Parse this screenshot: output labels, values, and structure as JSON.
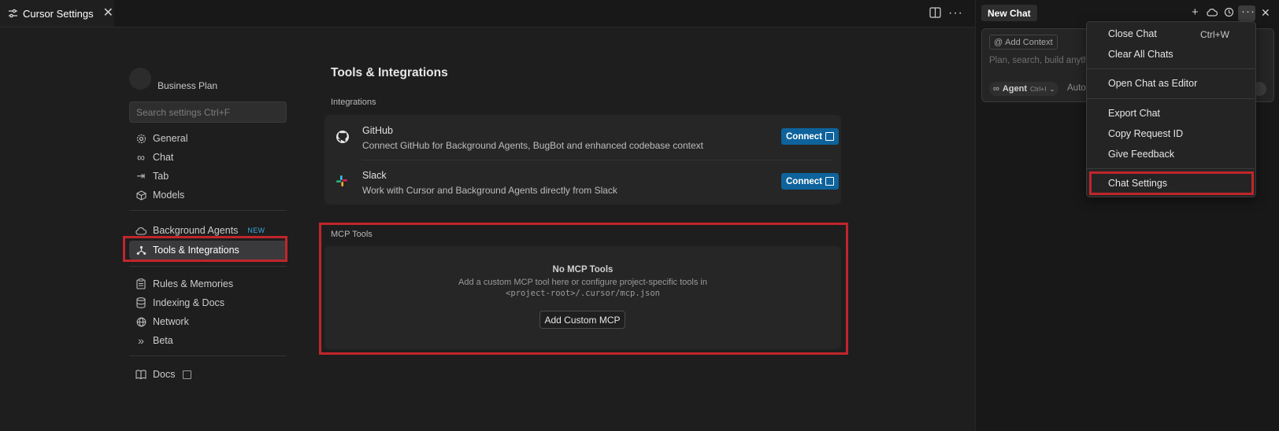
{
  "tab": {
    "title": "Cursor Settings"
  },
  "sidebar": {
    "plan": "Business Plan",
    "search_placeholder": "Search settings Ctrl+F",
    "items": [
      {
        "label": "General",
        "icon": "gear-icon"
      },
      {
        "label": "Chat",
        "icon": "infinity-icon"
      },
      {
        "label": "Tab",
        "icon": "tab-arrow-icon"
      },
      {
        "label": "Models",
        "icon": "cube-icon"
      },
      {
        "label": "Background Agents",
        "icon": "cloud-icon",
        "badge": "NEW"
      },
      {
        "label": "Tools & Integrations",
        "icon": "tools-icon",
        "active": true
      },
      {
        "label": "Rules & Memories",
        "icon": "clipboard-icon"
      },
      {
        "label": "Indexing & Docs",
        "icon": "database-icon"
      },
      {
        "label": "Network",
        "icon": "globe-icon"
      },
      {
        "label": "Beta",
        "icon": "chevrons-right-icon"
      },
      {
        "label": "Docs",
        "icon": "book-icon"
      }
    ]
  },
  "main": {
    "title": "Tools & Integrations",
    "integrations_title": "Integrations",
    "integrations": [
      {
        "name": "GitHub",
        "description": "Connect GitHub for Background Agents, BugBot and enhanced codebase context",
        "button": "Connect",
        "icon": "github-icon"
      },
      {
        "name": "Slack",
        "description": "Work with Cursor and Background Agents directly from Slack",
        "button": "Connect",
        "icon": "slack-icon"
      }
    ],
    "mcp": {
      "title": "MCP Tools",
      "empty_title": "No MCP Tools",
      "empty_desc": "Add a custom MCP tool here or configure project-specific tools in",
      "empty_path": "<project-root>/.cursor/mcp.json",
      "add_button": "Add Custom MCP"
    }
  },
  "chat": {
    "tab_title": "New Chat",
    "add_context": "Add Context",
    "placeholder": "Plan, search, build anyth",
    "agent_label": "Agent",
    "agent_shortcut": "Ctrl+I",
    "model_label": "Auto"
  },
  "menu": {
    "items": [
      {
        "label": "Close Chat",
        "shortcut": "Ctrl+W"
      },
      {
        "label": "Clear All Chats"
      },
      {
        "label": "Open Chat as Editor"
      },
      {
        "label": "Export Chat"
      },
      {
        "label": "Copy Request ID"
      },
      {
        "label": "Give Feedback"
      },
      {
        "label": "Chat Settings"
      }
    ]
  },
  "colors": {
    "accent": "#0e639c",
    "highlight": "#c0262b",
    "new_badge": "#3ea6e0"
  }
}
